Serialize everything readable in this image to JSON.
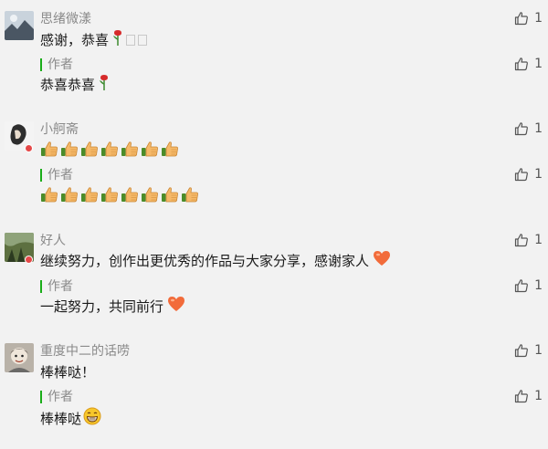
{
  "comments": [
    {
      "name": "思绪微漾",
      "text": "感谢，恭喜",
      "likes": "1",
      "reply": {
        "author_label": "作者",
        "text": "恭喜恭喜",
        "likes": "1"
      }
    },
    {
      "name": "小舸斋",
      "text": "",
      "likes": "1",
      "reply": {
        "author_label": "作者",
        "text": "",
        "likes": "1"
      }
    },
    {
      "name": "好人",
      "text": "继续努力，创作出更优秀的作品与大家分享，感谢家人",
      "likes": "1",
      "reply": {
        "author_label": "作者",
        "text": "一起努力，共同前行",
        "likes": "1"
      }
    },
    {
      "name": "重度中二的话唠",
      "text": "棒棒哒！",
      "likes": "1",
      "reply": {
        "author_label": "作者",
        "text": "棒棒哒",
        "likes": "1"
      }
    }
  ],
  "icons": {
    "like": "thumbs-up-outline-icon",
    "rose": "rose-icon",
    "thumbs": "thumbs-up-emoji-icon",
    "heart": "heart-icon",
    "grin": "grinning-emoji-icon"
  },
  "colors": {
    "author_bar": "#1aad19",
    "name": "#8a8a8a",
    "heart": "#f26b3a"
  }
}
